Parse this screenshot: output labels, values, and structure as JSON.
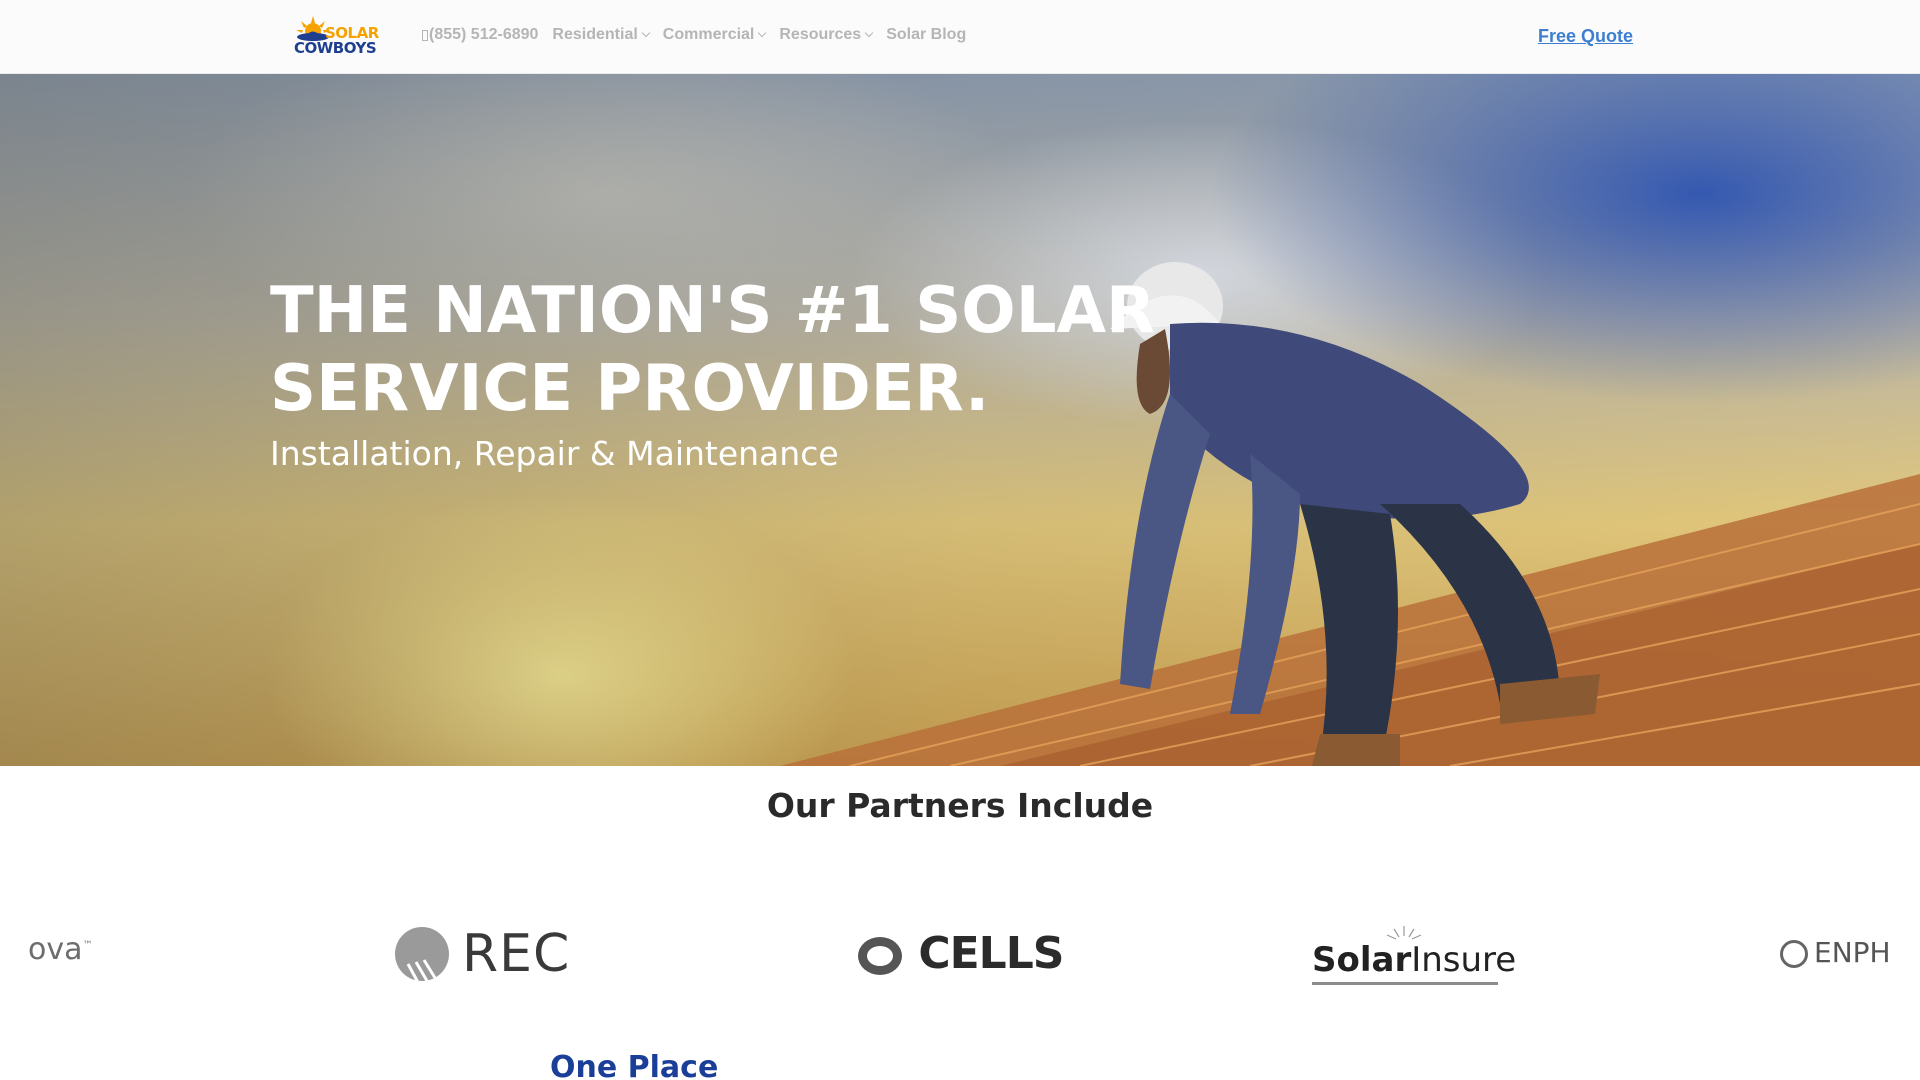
{
  "header": {
    "logo": {
      "line1": "SOLAR",
      "line2": "COWBOYS"
    },
    "nav": [
      {
        "label": "(855) 512-6890",
        "icon": "phone-icon",
        "has_dropdown": false
      },
      {
        "label": "Residential",
        "has_dropdown": true
      },
      {
        "label": "Commercial",
        "has_dropdown": true
      },
      {
        "label": "Resources",
        "has_dropdown": true
      },
      {
        "label": "Solar Blog",
        "has_dropdown": false
      }
    ],
    "cta": "Free Quote"
  },
  "hero": {
    "title_line1": "THE NATION'S #1 SOLAR",
    "title_line2": "SERVICE PROVIDER.",
    "subtitle": "Installation, Repair & Maintenance"
  },
  "partners": {
    "title": "Our Partners Include",
    "logos": [
      {
        "name": "ova",
        "text": "ova",
        "mark": "™"
      },
      {
        "name": "REC",
        "text": "REC"
      },
      {
        "name": "Q CELLS",
        "text": "CELLS"
      },
      {
        "name": "SolarInsure",
        "text_bold": "Solar",
        "text_regular": "Insure"
      },
      {
        "name": "ENPHASE",
        "text": "ENPH"
      }
    ]
  },
  "next_section": {
    "title": "One Place"
  },
  "colors": {
    "accent_link": "#3c7fd1",
    "logo_orange": "#f4a300",
    "logo_blue": "#1e3f8f",
    "heading_blue": "#1b3f99",
    "nav_gray": "#b5b5b5"
  }
}
